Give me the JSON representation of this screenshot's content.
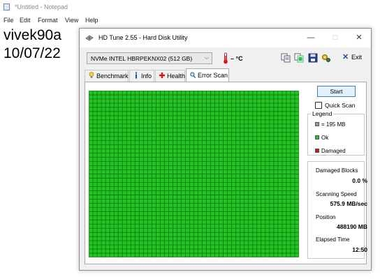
{
  "notepad": {
    "title": "*Untitled - Notepad",
    "menu": [
      "File",
      "Edit",
      "Format",
      "View",
      "Help"
    ],
    "text_lines": [
      "vivek90a",
      "10/07/22"
    ]
  },
  "window": {
    "title": "HD Tune 2.55 - Hard Disk Utility",
    "controls": {
      "minimize": "—",
      "maximize": "□",
      "close": "✕"
    }
  },
  "toolbar": {
    "drive": "NVMe    INTEL HBRPEKNX02 (512 GB)",
    "temperature": "– °C",
    "exit_label": "Exit",
    "icons": [
      "copy-info-icon",
      "copy-screen-icon",
      "save-icon",
      "options-icon"
    ]
  },
  "tabs": [
    {
      "label": "Benchmark",
      "icon": "lightbulb-icon"
    },
    {
      "label": "Info",
      "icon": "info-icon"
    },
    {
      "label": "Health",
      "icon": "health-cross-icon"
    },
    {
      "label": "Error Scan",
      "icon": "magnifier-icon",
      "active": true
    }
  ],
  "scan": {
    "start_label": "Start",
    "quick_scan_label": "Quick Scan",
    "quick_scan_checked": false,
    "grid_color": "#22c322",
    "grid_line_color": "#0b6e0b",
    "block_status": "ok"
  },
  "legend": {
    "title": "Legend",
    "items": [
      {
        "label": "= 195 MB",
        "color": "#9a9a9a"
      },
      {
        "label": "Ok",
        "color": "#22c322"
      },
      {
        "label": "Damaged",
        "color": "#d01818"
      }
    ]
  },
  "stats": {
    "damaged_blocks_label": "Damaged Blocks",
    "damaged_blocks_value": "0.0 %",
    "scanning_speed_label": "Scanning Speed",
    "scanning_speed_value": "575.9 MB/sec",
    "position_label": "Position",
    "position_value": "488190 MB",
    "elapsed_label": "Elapsed Time",
    "elapsed_value": "12:50"
  }
}
